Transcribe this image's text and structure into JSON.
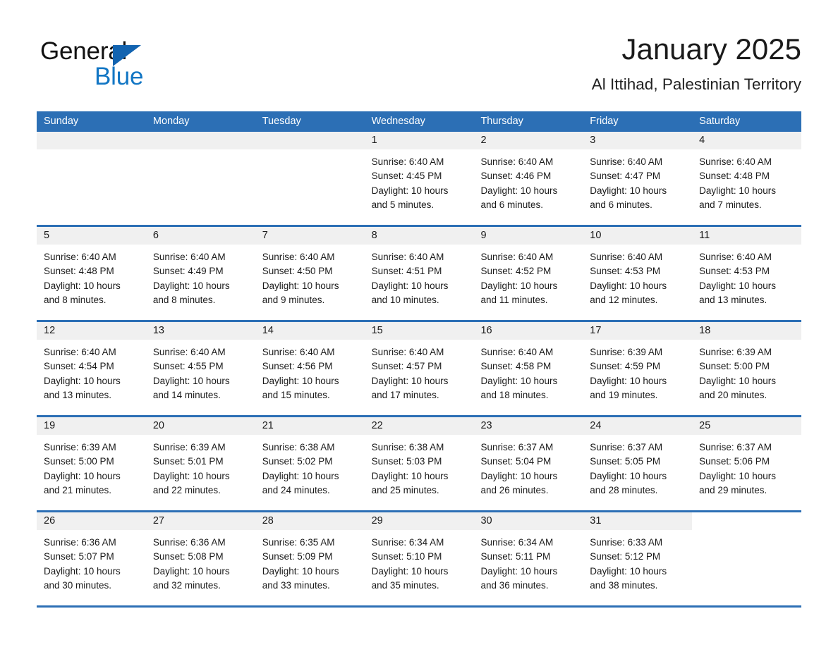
{
  "logo": {
    "word1": "General",
    "word2": "Blue",
    "triangle_color": "#1263b0",
    "blue_text_color": "#1276c4"
  },
  "header": {
    "title": "January 2025",
    "subtitle": "Al Ittihad, Palestinian Territory"
  },
  "theme": {
    "header_blue": "#2c6fb5",
    "date_band_gray": "#f0f0f0",
    "text_color": "#1a1a1a"
  },
  "weekday_headers": [
    "Sunday",
    "Monday",
    "Tuesday",
    "Wednesday",
    "Thursday",
    "Friday",
    "Saturday"
  ],
  "weeks": [
    [
      {
        "date": "",
        "blank": true
      },
      {
        "date": "",
        "blank": true
      },
      {
        "date": "",
        "blank": true
      },
      {
        "date": "1",
        "sunrise": "Sunrise: 6:40 AM",
        "sunset": "Sunset: 4:45 PM",
        "daylight_1": "Daylight: 10 hours",
        "daylight_2": "and 5 minutes."
      },
      {
        "date": "2",
        "sunrise": "Sunrise: 6:40 AM",
        "sunset": "Sunset: 4:46 PM",
        "daylight_1": "Daylight: 10 hours",
        "daylight_2": "and 6 minutes."
      },
      {
        "date": "3",
        "sunrise": "Sunrise: 6:40 AM",
        "sunset": "Sunset: 4:47 PM",
        "daylight_1": "Daylight: 10 hours",
        "daylight_2": "and 6 minutes."
      },
      {
        "date": "4",
        "sunrise": "Sunrise: 6:40 AM",
        "sunset": "Sunset: 4:48 PM",
        "daylight_1": "Daylight: 10 hours",
        "daylight_2": "and 7 minutes."
      }
    ],
    [
      {
        "date": "5",
        "sunrise": "Sunrise: 6:40 AM",
        "sunset": "Sunset: 4:48 PM",
        "daylight_1": "Daylight: 10 hours",
        "daylight_2": "and 8 minutes."
      },
      {
        "date": "6",
        "sunrise": "Sunrise: 6:40 AM",
        "sunset": "Sunset: 4:49 PM",
        "daylight_1": "Daylight: 10 hours",
        "daylight_2": "and 8 minutes."
      },
      {
        "date": "7",
        "sunrise": "Sunrise: 6:40 AM",
        "sunset": "Sunset: 4:50 PM",
        "daylight_1": "Daylight: 10 hours",
        "daylight_2": "and 9 minutes."
      },
      {
        "date": "8",
        "sunrise": "Sunrise: 6:40 AM",
        "sunset": "Sunset: 4:51 PM",
        "daylight_1": "Daylight: 10 hours",
        "daylight_2": "and 10 minutes."
      },
      {
        "date": "9",
        "sunrise": "Sunrise: 6:40 AM",
        "sunset": "Sunset: 4:52 PM",
        "daylight_1": "Daylight: 10 hours",
        "daylight_2": "and 11 minutes."
      },
      {
        "date": "10",
        "sunrise": "Sunrise: 6:40 AM",
        "sunset": "Sunset: 4:53 PM",
        "daylight_1": "Daylight: 10 hours",
        "daylight_2": "and 12 minutes."
      },
      {
        "date": "11",
        "sunrise": "Sunrise: 6:40 AM",
        "sunset": "Sunset: 4:53 PM",
        "daylight_1": "Daylight: 10 hours",
        "daylight_2": "and 13 minutes."
      }
    ],
    [
      {
        "date": "12",
        "sunrise": "Sunrise: 6:40 AM",
        "sunset": "Sunset: 4:54 PM",
        "daylight_1": "Daylight: 10 hours",
        "daylight_2": "and 13 minutes."
      },
      {
        "date": "13",
        "sunrise": "Sunrise: 6:40 AM",
        "sunset": "Sunset: 4:55 PM",
        "daylight_1": "Daylight: 10 hours",
        "daylight_2": "and 14 minutes."
      },
      {
        "date": "14",
        "sunrise": "Sunrise: 6:40 AM",
        "sunset": "Sunset: 4:56 PM",
        "daylight_1": "Daylight: 10 hours",
        "daylight_2": "and 15 minutes."
      },
      {
        "date": "15",
        "sunrise": "Sunrise: 6:40 AM",
        "sunset": "Sunset: 4:57 PM",
        "daylight_1": "Daylight: 10 hours",
        "daylight_2": "and 17 minutes."
      },
      {
        "date": "16",
        "sunrise": "Sunrise: 6:40 AM",
        "sunset": "Sunset: 4:58 PM",
        "daylight_1": "Daylight: 10 hours",
        "daylight_2": "and 18 minutes."
      },
      {
        "date": "17",
        "sunrise": "Sunrise: 6:39 AM",
        "sunset": "Sunset: 4:59 PM",
        "daylight_1": "Daylight: 10 hours",
        "daylight_2": "and 19 minutes."
      },
      {
        "date": "18",
        "sunrise": "Sunrise: 6:39 AM",
        "sunset": "Sunset: 5:00 PM",
        "daylight_1": "Daylight: 10 hours",
        "daylight_2": "and 20 minutes."
      }
    ],
    [
      {
        "date": "19",
        "sunrise": "Sunrise: 6:39 AM",
        "sunset": "Sunset: 5:00 PM",
        "daylight_1": "Daylight: 10 hours",
        "daylight_2": "and 21 minutes."
      },
      {
        "date": "20",
        "sunrise": "Sunrise: 6:39 AM",
        "sunset": "Sunset: 5:01 PM",
        "daylight_1": "Daylight: 10 hours",
        "daylight_2": "and 22 minutes."
      },
      {
        "date": "21",
        "sunrise": "Sunrise: 6:38 AM",
        "sunset": "Sunset: 5:02 PM",
        "daylight_1": "Daylight: 10 hours",
        "daylight_2": "and 24 minutes."
      },
      {
        "date": "22",
        "sunrise": "Sunrise: 6:38 AM",
        "sunset": "Sunset: 5:03 PM",
        "daylight_1": "Daylight: 10 hours",
        "daylight_2": "and 25 minutes."
      },
      {
        "date": "23",
        "sunrise": "Sunrise: 6:37 AM",
        "sunset": "Sunset: 5:04 PM",
        "daylight_1": "Daylight: 10 hours",
        "daylight_2": "and 26 minutes."
      },
      {
        "date": "24",
        "sunrise": "Sunrise: 6:37 AM",
        "sunset": "Sunset: 5:05 PM",
        "daylight_1": "Daylight: 10 hours",
        "daylight_2": "and 28 minutes."
      },
      {
        "date": "25",
        "sunrise": "Sunrise: 6:37 AM",
        "sunset": "Sunset: 5:06 PM",
        "daylight_1": "Daylight: 10 hours",
        "daylight_2": "and 29 minutes."
      }
    ],
    [
      {
        "date": "26",
        "sunrise": "Sunrise: 6:36 AM",
        "sunset": "Sunset: 5:07 PM",
        "daylight_1": "Daylight: 10 hours",
        "daylight_2": "and 30 minutes."
      },
      {
        "date": "27",
        "sunrise": "Sunrise: 6:36 AM",
        "sunset": "Sunset: 5:08 PM",
        "daylight_1": "Daylight: 10 hours",
        "daylight_2": "and 32 minutes."
      },
      {
        "date": "28",
        "sunrise": "Sunrise: 6:35 AM",
        "sunset": "Sunset: 5:09 PM",
        "daylight_1": "Daylight: 10 hours",
        "daylight_2": "and 33 minutes."
      },
      {
        "date": "29",
        "sunrise": "Sunrise: 6:34 AM",
        "sunset": "Sunset: 5:10 PM",
        "daylight_1": "Daylight: 10 hours",
        "daylight_2": "and 35 minutes."
      },
      {
        "date": "30",
        "sunrise": "Sunrise: 6:34 AM",
        "sunset": "Sunset: 5:11 PM",
        "daylight_1": "Daylight: 10 hours",
        "daylight_2": "and 36 minutes."
      },
      {
        "date": "31",
        "sunrise": "Sunrise: 6:33 AM",
        "sunset": "Sunset: 5:12 PM",
        "daylight_1": "Daylight: 10 hours",
        "daylight_2": "and 38 minutes."
      },
      {
        "date": "",
        "empty": true
      }
    ]
  ]
}
